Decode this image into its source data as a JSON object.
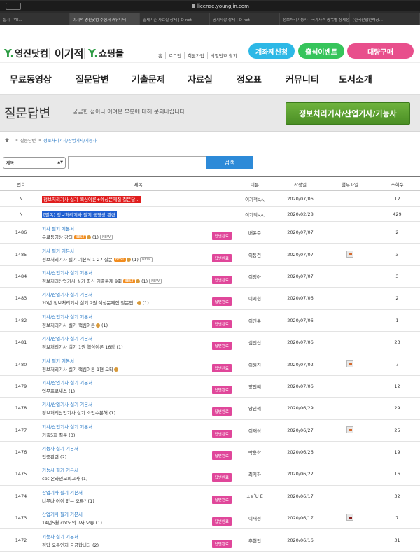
{
  "browser": {
    "url": "license.youngjin.com",
    "tabs": [
      {
        "label": "실기 - YE...",
        "active": false
      },
      {
        "label": "이기적 영진닷컴 수험서 커뮤니티",
        "active": true
      },
      {
        "label": "출제기준 자료실 상세 | Q-net",
        "active": false
      },
      {
        "label": "공지사항 상세 | Q-net",
        "active": false
      },
      {
        "label": "정보처리기능사 - 국가자격 종목별 상세정...",
        "active": false
      },
      {
        "label": "[한국산업인력공...",
        "active": false
      }
    ]
  },
  "header": {
    "logo1": {
      "y": "Y.",
      "text": "영진닷컴"
    },
    "logo2": {
      "text": "이기적"
    },
    "logo3": {
      "y": "Y.",
      "text": "쇼핑몰"
    },
    "util_links": [
      "홈",
      "로그인",
      "회원가입",
      "비밀번호 찾기"
    ],
    "pills": [
      {
        "label": "계좌제신청",
        "color": "#2db8e6"
      },
      {
        "label": "출석이벤트",
        "color": "#36c45b"
      },
      {
        "label": "대량구매",
        "color": "#e84f8c"
      }
    ]
  },
  "nav": [
    "무료동영상",
    "질문답변",
    "기출문제",
    "자료실",
    "정오표",
    "커뮤니티",
    "도서소개"
  ],
  "banner": {
    "title": "질문답변",
    "subtitle": "궁금한 점이나 어려운 부분에 대해 문의바랍니다",
    "button": "정보처리기사/산업기사/기능사"
  },
  "breadcrumb": [
    "질문답변",
    "정보처리기사/산업기사/기능사"
  ],
  "search": {
    "select_value": "제목",
    "button": "검색"
  },
  "table": {
    "headers": [
      "번호",
      "제목",
      "이름",
      "작성일",
      "첨부파일",
      "조회수"
    ],
    "notices": [
      {
        "no": "N",
        "title": "정보처리기사 실기 핵심이론+예상문제집 질문답...",
        "name": "이기적s人",
        "date": "2020/07/06",
        "views": "12",
        "style": "red"
      },
      {
        "no": "N",
        "title": "[필독] 정보처리기사 필기 동영상 관련",
        "name": "이기적s人",
        "date": "2020/02/28",
        "views": "429",
        "style": "blue"
      }
    ],
    "rows": [
      {
        "no": "1486",
        "cat": "기사 필기 기본서",
        "title": "무료동영상 강의",
        "best": true,
        "dot": true,
        "count": "(1)",
        "new": true,
        "status": "답변완료",
        "name": "배윤주",
        "date": "2020/07/07",
        "attach": "",
        "views": "2"
      },
      {
        "no": "1485",
        "cat": "기사 필기 기본서",
        "title": "정보처리기사 필기 기본서 1-27 질문",
        "best": true,
        "dot": true,
        "count": "(1)",
        "new": true,
        "status": "답변완료",
        "name": "이동건",
        "date": "2020/07/07",
        "attach": "orange",
        "views": "3"
      },
      {
        "no": "1484",
        "cat": "기사/산업기사 실기 기본서",
        "title": "정보처리산업기사 실기 최신 기출문제 9회",
        "best": true,
        "dot": true,
        "count": "(1)",
        "new": true,
        "status": "답변완료",
        "name": "이정아",
        "date": "2020/07/07",
        "attach": "",
        "views": "3"
      },
      {
        "no": "1483",
        "cat": "기사/산업기사 실기 기본서",
        "title": "20년 정보처리기사 실기 2권 예상문제집 질문입..",
        "best": false,
        "dot": true,
        "count": "(1)",
        "new": false,
        "status": "답변완료",
        "name": "이지현",
        "date": "2020/07/06",
        "attach": "",
        "views": "2"
      },
      {
        "no": "1482",
        "cat": "기사/산업기사 실기 기본서",
        "title": "정보처리기사 실기 핵심이론",
        "best": false,
        "dot": true,
        "count": "(1)",
        "new": false,
        "status": "답변완료",
        "name": "이민수",
        "date": "2020/07/06",
        "attach": "",
        "views": "1"
      },
      {
        "no": "1481",
        "cat": "기사/산업기사 실기 기본서",
        "title": "정보처리기사 실기 1권 핵심이론 16강",
        "best": false,
        "dot": false,
        "count": "(1)",
        "new": false,
        "status": "답변완료",
        "name": "심민섭",
        "date": "2020/07/06",
        "attach": "",
        "views": "23"
      },
      {
        "no": "1480",
        "cat": "기사 필기 기본서",
        "title": "정보처리기사 실기 핵심이론 1편 오타",
        "best": false,
        "dot": true,
        "count": "",
        "new": false,
        "status": "답변완료",
        "name": "이원진",
        "date": "2020/07/02",
        "attach": "orange",
        "views": "7"
      },
      {
        "no": "1479",
        "cat": "기사/산업기사 실기 기본서",
        "title": "업무프로세스 (1)",
        "best": false,
        "dot": false,
        "count": "",
        "new": false,
        "status": "답변완료",
        "name": "양인혜",
        "date": "2020/07/06",
        "attach": "",
        "views": "12"
      },
      {
        "no": "1478",
        "cat": "기사/산업기사 실기 기본서",
        "title": "정보처리산업기사 실기 소인수분해 (1)",
        "best": false,
        "dot": false,
        "count": "",
        "new": false,
        "status": "답변완료",
        "name": "양인혜",
        "date": "2020/06/29",
        "attach": "",
        "views": "29"
      },
      {
        "no": "1477",
        "cat": "기사/산업기사 실기 기본서",
        "title": "기출5회 질문 (3)",
        "best": false,
        "dot": false,
        "count": "",
        "new": false,
        "status": "답변완료",
        "name": "이재성",
        "date": "2020/06/27",
        "attach": "orange",
        "views": "25"
      },
      {
        "no": "1476",
        "cat": "기능사 실기 기본서",
        "title": "인증관련 (2)",
        "best": false,
        "dot": false,
        "count": "",
        "new": false,
        "status": "답변완료",
        "name": "박용학",
        "date": "2020/06/26",
        "attach": "",
        "views": "19"
      },
      {
        "no": "1475",
        "cat": "기능사 필기 기본서",
        "title": "cbt 온라인모의고사 (1)",
        "best": false,
        "dot": false,
        "count": "",
        "new": false,
        "status": "답변완료",
        "name": "최지하",
        "date": "2020/06/22",
        "attach": "",
        "views": "16"
      },
      {
        "no": "1474",
        "cat": "산업기사 필기 기본서",
        "title": "너무나 어이 없는 오류? (1)",
        "best": false,
        "dot": false,
        "count": "",
        "new": false,
        "status": "답변완료",
        "name": "±e´U·E",
        "date": "2020/06/17",
        "attach": "",
        "views": "32"
      },
      {
        "no": "1473",
        "cat": "산업기사 필기 기본서",
        "title": "14년5월 cbt모의고사 오류 (1)",
        "best": false,
        "dot": false,
        "count": "",
        "new": false,
        "status": "답변완료",
        "name": "이재성",
        "date": "2020/06/17",
        "attach": "dark",
        "views": "7"
      },
      {
        "no": "1472",
        "cat": "기능사 실기 기본서",
        "title": "정답 오류인지 궁금합니다 (2)",
        "best": false,
        "dot": false,
        "count": "",
        "new": false,
        "status": "답변완료",
        "name": "추현인",
        "date": "2020/06/16",
        "attach": "",
        "views": "31"
      }
    ]
  }
}
